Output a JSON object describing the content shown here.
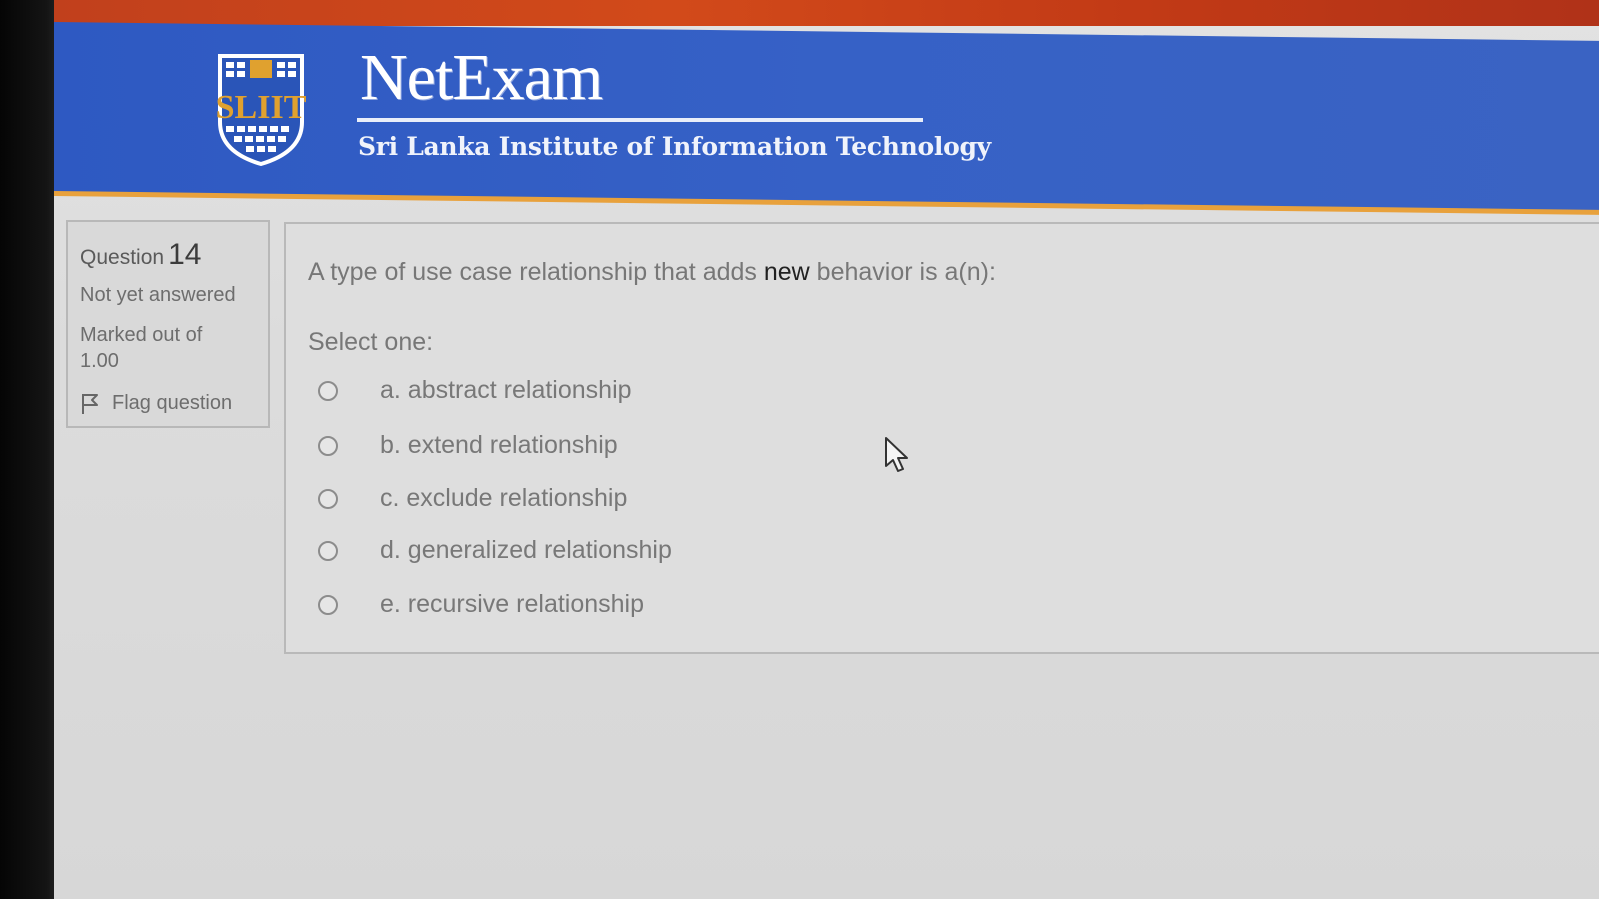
{
  "header": {
    "title": "NetExam",
    "subtitle": "Sri Lanka Institute of Information Technology",
    "logo_text": "SLIIT"
  },
  "question_info": {
    "label": "Question",
    "number": "14",
    "state": "Not yet answered",
    "mark_label": "Marked out of",
    "mark_value": "1.00",
    "flag_label": "Flag question"
  },
  "question": {
    "text_before": "A type of use case relationship that adds ",
    "text_bold": "new",
    "text_after": " behavior is a(n):",
    "prompt": "Select one:",
    "options": [
      {
        "label": "a. abstract relationship"
      },
      {
        "label": "b. extend relationship"
      },
      {
        "label": "c. exclude relationship"
      },
      {
        "label": "d. generalized relationship"
      },
      {
        "label": "e. recursive relationship"
      }
    ]
  },
  "colors": {
    "header_blue": "#3661c6",
    "top_strip": "#d24a1a",
    "accent_orange": "#e8a13c"
  }
}
